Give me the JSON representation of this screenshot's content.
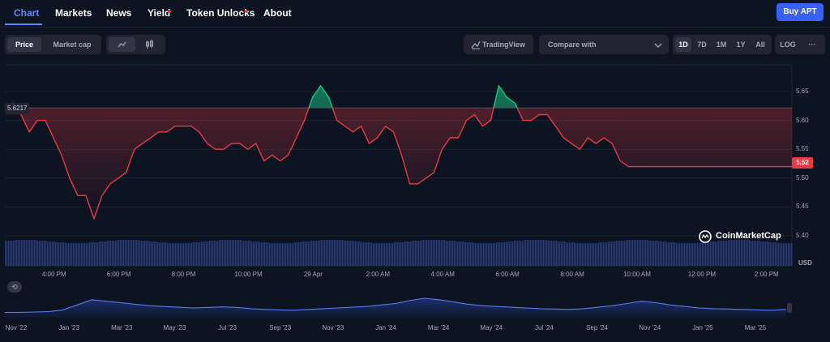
{
  "nav": {
    "tabs": [
      {
        "label": "Chart",
        "active": true
      },
      {
        "label": "Markets",
        "active": false
      },
      {
        "label": "News",
        "active": false
      },
      {
        "label": "Yield",
        "active": false,
        "dot": true
      },
      {
        "label": "Token Unlocks",
        "active": false,
        "dot": true
      },
      {
        "label": "About",
        "active": false
      }
    ],
    "buy_label": "Buy APT"
  },
  "toolbar": {
    "price_label": "Price",
    "market_cap_label": "Market cap",
    "line_icon": "line-chart-icon",
    "candle_icon": "candlestick-icon",
    "tradingview_label": "TradingView",
    "compare_label": "Compare with",
    "ranges": [
      "1D",
      "7D",
      "1M",
      "1Y",
      "All"
    ],
    "active_range": "1D",
    "log_label": "LOG",
    "more_label": "···"
  },
  "colors": {
    "up": "#16c784",
    "down": "#ea3943",
    "accent": "#6188ff",
    "volume": "#3b4a86"
  },
  "chart_data": {
    "type": "line",
    "currency_label": "USD",
    "open_price_label": "5.6217",
    "open_price": 5.6217,
    "current_price_label": "5.52",
    "y_ticks": [
      "5.65",
      "5.60",
      "5.55",
      "5.50",
      "5.45",
      "5.40"
    ],
    "y_tick_values": [
      5.65,
      5.6,
      5.55,
      5.5,
      5.45,
      5.4
    ],
    "ylim": [
      5.4,
      5.65
    ],
    "x_ticks": [
      "4:00 PM",
      "6:00 PM",
      "8:00 PM",
      "10:00 PM",
      "29 Apr",
      "2:00 AM",
      "4:00 AM",
      "6:00 AM",
      "8:00 AM",
      "10:00 AM",
      "12:00 PM",
      "2:00 PM"
    ],
    "x_tick_hours": [
      1.52,
      3.52,
      5.52,
      7.52,
      9.52,
      11.52,
      13.52,
      15.52,
      17.52,
      19.52,
      21.52,
      23.52
    ],
    "x_end_hours": 24.3,
    "series": [
      {
        "x": [
          0,
          0.25,
          0.5,
          0.75,
          1.0,
          1.25,
          1.5,
          1.75,
          2.0,
          2.25,
          2.5,
          2.75,
          3.0,
          3.25,
          3.5,
          3.75,
          4.0,
          4.25,
          4.5,
          4.75,
          5.0,
          5.25,
          5.5,
          5.75,
          6.0,
          6.25,
          6.5,
          6.75,
          7.0,
          7.25,
          7.5,
          7.75,
          8.0,
          8.25,
          8.5,
          8.75,
          9.0,
          9.25,
          9.5,
          9.75,
          10.0,
          10.25,
          10.5,
          10.75,
          11.0,
          11.25,
          11.5,
          11.75,
          12.0,
          12.25,
          12.5,
          12.75,
          13.0,
          13.25,
          13.5,
          13.75,
          14.0,
          14.25,
          14.5,
          14.75,
          15.0,
          15.25,
          15.5,
          15.75,
          16.0,
          16.25,
          16.5,
          16.75,
          17.0,
          17.25,
          17.5,
          17.75,
          18.0,
          18.25,
          18.5,
          18.75,
          19.0,
          19.25,
          19.5,
          19.75,
          20.0,
          20.25,
          20.5,
          20.75,
          21.0,
          21.25,
          21.5,
          21.75,
          22.0,
          22.25,
          22.5,
          22.75,
          23.0,
          23.25,
          23.5,
          23.75,
          24.0,
          24.3
        ],
        "values": [
          5.62,
          5.63,
          5.61,
          5.58,
          5.6,
          5.6,
          5.57,
          5.54,
          5.5,
          5.47,
          5.47,
          5.43,
          5.47,
          5.49,
          5.5,
          5.51,
          5.55,
          5.56,
          5.57,
          5.58,
          5.58,
          5.59,
          5.59,
          5.59,
          5.58,
          5.56,
          5.55,
          5.55,
          5.56,
          5.56,
          5.55,
          5.56,
          5.53,
          5.54,
          5.53,
          5.54,
          5.57,
          5.6,
          5.64,
          5.66,
          5.64,
          5.6,
          5.59,
          5.58,
          5.59,
          5.56,
          5.57,
          5.59,
          5.58,
          5.54,
          5.49,
          5.49,
          5.5,
          5.51,
          5.55,
          5.57,
          5.57,
          5.6,
          5.61,
          5.59,
          5.6,
          5.66,
          5.64,
          5.63,
          5.6,
          5.6,
          5.61,
          5.61,
          5.59,
          5.57,
          5.56,
          5.55,
          5.57,
          5.56,
          5.57,
          5.56,
          5.53,
          5.52,
          5.52,
          5.52,
          5.52,
          5.52,
          5.52,
          5.52,
          5.52,
          5.52,
          5.52,
          5.52,
          5.52,
          5.52,
          5.52,
          5.52,
          5.52,
          5.52,
          5.52,
          5.52,
          5.52,
          5.52
        ]
      }
    ],
    "brand_label": "CoinMarketCap",
    "navigator": {
      "x_ticks": [
        "Nov '22",
        "Jan '23",
        "Mar '23",
        "May '23",
        "Jul '23",
        "Sep '23",
        "Nov '23",
        "Jan '24",
        "Mar '24",
        "May '24",
        "Jul '24",
        "Sep '24",
        "Nov '24",
        "Jan '25",
        "Mar '25"
      ],
      "values": [
        3.5,
        3.6,
        3.8,
        4.0,
        5.2,
        8.5,
        12.0,
        11.0,
        10.0,
        9.0,
        8.0,
        7.5,
        7.0,
        6.5,
        6.8,
        7.2,
        6.9,
        6.0,
        5.5,
        5.2,
        5.0,
        5.5,
        6.0,
        6.5,
        7.0,
        7.5,
        8.5,
        9.5,
        11.5,
        13.0,
        12.0,
        10.5,
        9.0,
        8.0,
        7.5,
        7.0,
        6.5,
        6.0,
        5.8,
        5.5,
        6.0,
        7.0,
        8.0,
        9.5,
        11.0,
        10.0,
        8.5,
        7.5,
        6.5,
        6.0,
        5.8,
        5.5,
        5.2,
        5.0,
        5.52
      ]
    }
  }
}
